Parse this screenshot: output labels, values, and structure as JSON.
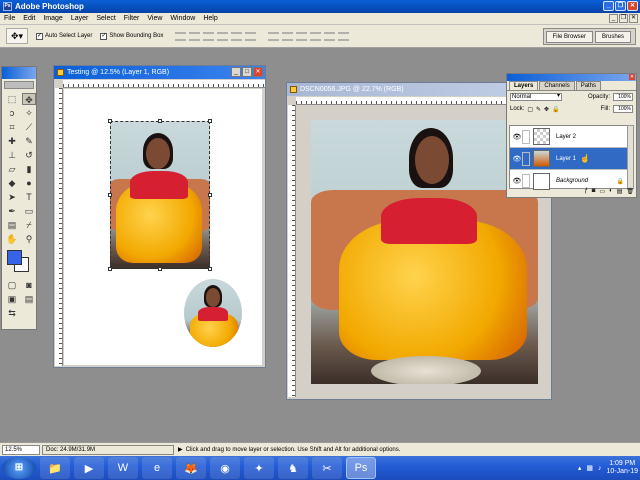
{
  "app": {
    "title": "Adobe Photoshop"
  },
  "menu": [
    "File",
    "Edit",
    "Image",
    "Layer",
    "Select",
    "Filter",
    "View",
    "Window",
    "Help"
  ],
  "options": {
    "auto_select_label": "Auto Select Layer",
    "auto_select_checked": "✓",
    "bounding_box_label": "Show Bounding Box",
    "bounding_box_checked": "✓",
    "well_tabs": [
      "File Browser",
      "Brushes"
    ]
  },
  "doc1": {
    "title": "Testing @ 12.5% (Layer 1, RGB)"
  },
  "doc2": {
    "title": "DSCN0056.JPG @ 22.7% (RGB)"
  },
  "layers_palette": {
    "tabs": [
      "Layers",
      "Channels",
      "Paths"
    ],
    "blend_mode": "Normal",
    "opacity_label": "Opacity:",
    "opacity_value": "100%",
    "lock_label": "Lock:",
    "fill_label": "Fill:",
    "fill_value": "100%",
    "layers": [
      {
        "name": "Layer 2",
        "visible_icon": "eye-icon",
        "thumb": "transparent"
      },
      {
        "name": "Layer 1",
        "visible_icon": "eye-icon",
        "thumb": "image",
        "selected": true
      },
      {
        "name": "Background",
        "visible_icon": "eye-icon",
        "thumb": "white",
        "locked": true
      }
    ]
  },
  "status": {
    "zoom": "12.5%",
    "doc": "Doc: 24.9M/31.9M",
    "message": "Click and drag to move layer or selection. Use Shift and Alt for additional options."
  },
  "taskbar": {
    "time": "1:09 PM",
    "date": "10-Jan-19"
  },
  "colors": {
    "foreground": "#3763e8",
    "background": "#ffffff",
    "title_bar": "#0a5fd8"
  }
}
